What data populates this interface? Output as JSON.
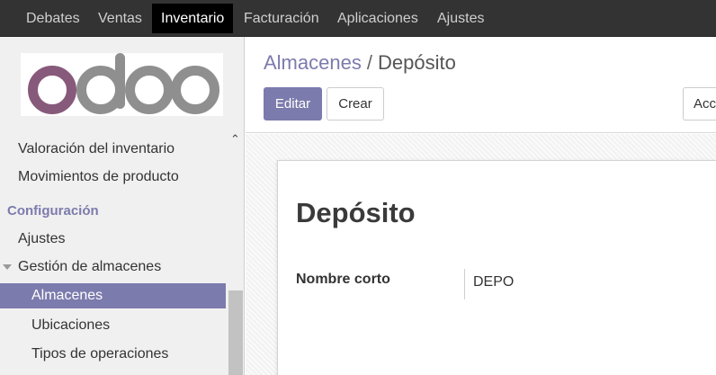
{
  "topnav": {
    "items": [
      "Debates",
      "Ventas",
      "Inventario",
      "Facturación",
      "Aplicaciones",
      "Ajustes"
    ],
    "active": "Inventario",
    "colors": {
      "bar": "#333333",
      "active_bg": "#000000"
    }
  },
  "logo": {
    "text": "odoo",
    "colors": {
      "o1": "#875a7b",
      "rest": "#8f8f8f"
    }
  },
  "sidebar": {
    "items": [
      {
        "label": "Valoración del inventario"
      },
      {
        "label": "Movimientos de producto"
      }
    ],
    "section": "Configuración",
    "config_items": [
      {
        "label": "Ajustes"
      },
      {
        "label": "Gestión de almacenes"
      }
    ],
    "sub_items": [
      {
        "label": "Almacenes",
        "active": true
      },
      {
        "label": "Ubicaciones"
      },
      {
        "label": "Tipos de operaciones"
      }
    ],
    "accent_color": "#7c7bad"
  },
  "control_panel": {
    "breadcrumb": {
      "parent": "Almacenes",
      "separator": "/",
      "current": "Depósito"
    },
    "buttons": {
      "edit": "Editar",
      "create": "Crear",
      "action": "Acc"
    }
  },
  "form": {
    "title": "Depósito",
    "fields": [
      {
        "label": "Nombre corto",
        "value": "DEPO"
      }
    ]
  }
}
